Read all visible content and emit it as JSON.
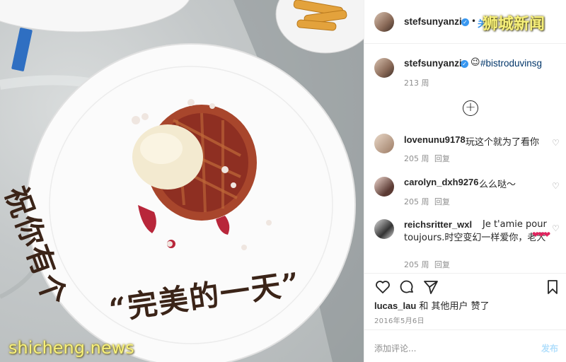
{
  "photo": {
    "plate_line1": "祝你有个",
    "plate_line2": "“完美的一天”",
    "watermark_bottom": "shicheng.news"
  },
  "header": {
    "username": "stefsunyanzi",
    "follow_label": "关注",
    "watermark_top": "狮城新闻"
  },
  "caption": {
    "username": "stefsunyanzi",
    "emoji": "😉",
    "hashtag": "#bistroduvinsg",
    "age": "213 周"
  },
  "comments": [
    {
      "user": "lovenunu9178",
      "text": "玩这个就为了看你",
      "age": "205 周",
      "reply": "回复"
    },
    {
      "user": "carolyn_dxh9276",
      "text": "么么哒～",
      "age": "205 周",
      "reply": "回复"
    },
    {
      "user": "reichsritter_wxl",
      "text_line1": "Je t'amie pour",
      "text_line2": "toujours.时空变幻一样爱你，老大",
      "hearts": "❤❤❤",
      "age": "205 周",
      "reply": "回复"
    }
  ],
  "actions": {
    "liked_by_user": "lucas_lau",
    "liked_by_rest": " 和 其他用户 赞了",
    "date": "2016年5月6日"
  },
  "comment_box": {
    "placeholder": "添加评论...",
    "post_label": "发布"
  },
  "colors": {
    "link": "#3897f0",
    "hashtag": "#003569",
    "muted": "#8e8e8e",
    "watermark": "#f7f07a",
    "heart": "#e0245e"
  },
  "icons": [
    "verified-badge-icon",
    "load-more-icon",
    "like-heart-icon",
    "comment-icon",
    "share-icon",
    "bookmark-icon"
  ]
}
